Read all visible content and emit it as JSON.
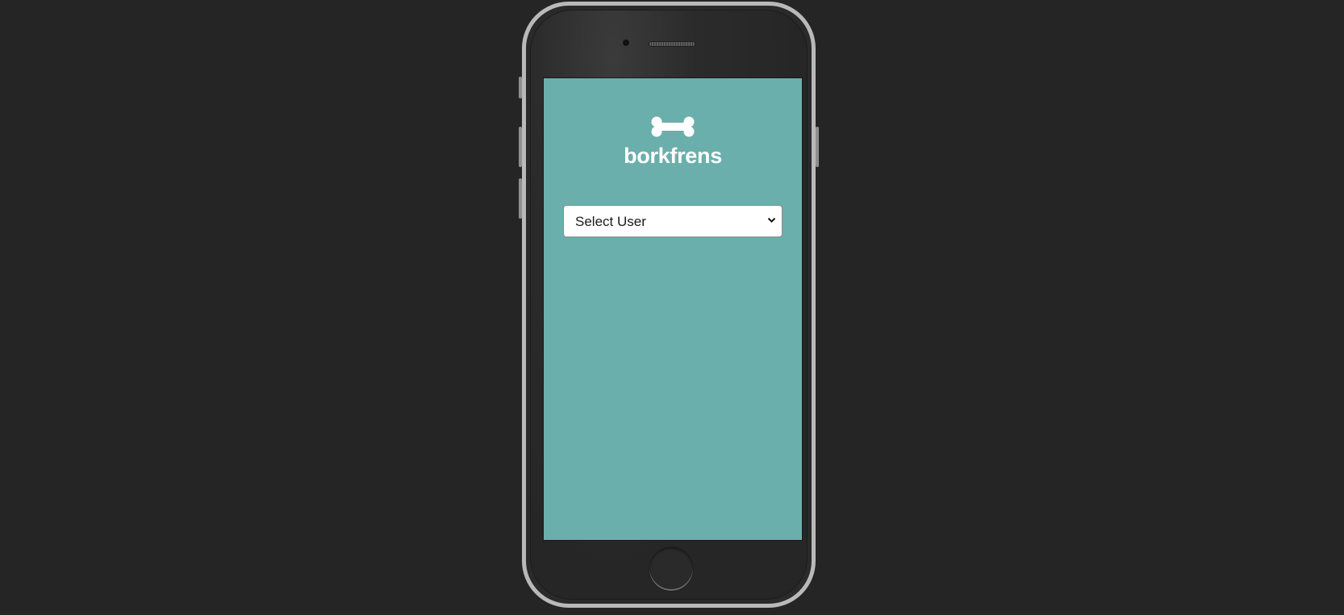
{
  "app": {
    "brand_name": "borkfrens",
    "logo_icon": "bone-icon"
  },
  "user_select": {
    "selected_label": "Select User",
    "options": [
      "Select User"
    ]
  },
  "colors": {
    "page_background": "#252525",
    "screen_background": "#6aafab",
    "brand_text": "#ffffff",
    "phone_frame": "#b9b9b9"
  }
}
